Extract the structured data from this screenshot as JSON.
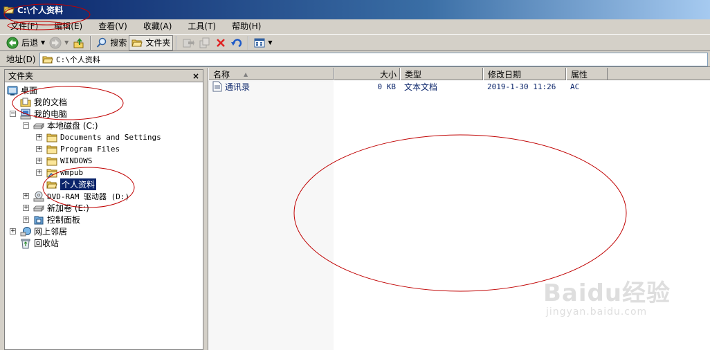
{
  "window": {
    "title": "C:\\个人资料"
  },
  "menu": [
    "文件(F)",
    "编辑(E)",
    "查看(V)",
    "收藏(A)",
    "工具(T)",
    "帮助(H)"
  ],
  "toolbar": {
    "back": "后退",
    "search": "搜索",
    "folders": "文件夹"
  },
  "address": {
    "label": "地址(D)",
    "value": "C:\\个人资料"
  },
  "folder_pane": {
    "title": "文件夹",
    "close": "×",
    "tree": [
      {
        "label": "桌面"
      },
      {
        "label": "我的文档"
      },
      {
        "label": "我的电脑"
      },
      {
        "label": "本地磁盘 (C:)"
      },
      {
        "label": "Documents and Settings"
      },
      {
        "label": "Program Files"
      },
      {
        "label": "WINDOWS"
      },
      {
        "label": "wmpub"
      },
      {
        "label": "个人资料",
        "selected": true
      },
      {
        "label": "DVD-RAM 驱动器 (D:)"
      },
      {
        "label": "新加卷 (E:)"
      },
      {
        "label": "控制面板"
      },
      {
        "label": "网上邻居"
      },
      {
        "label": "回收站"
      }
    ]
  },
  "list": {
    "columns": [
      "名称",
      "大小",
      "类型",
      "修改日期",
      "属性"
    ],
    "rows": [
      {
        "name": "通讯录",
        "size": "0 KB",
        "type": "文本文档",
        "modified": "2019-1-30 11:26",
        "attributes": "AC"
      }
    ]
  },
  "watermark": {
    "logo": "Baidu经验",
    "sub": "jingyan.baidu.com"
  },
  "colors": {
    "titlebar": "#0a246a",
    "selection": "#0a246a",
    "annotation": "#c00000"
  }
}
